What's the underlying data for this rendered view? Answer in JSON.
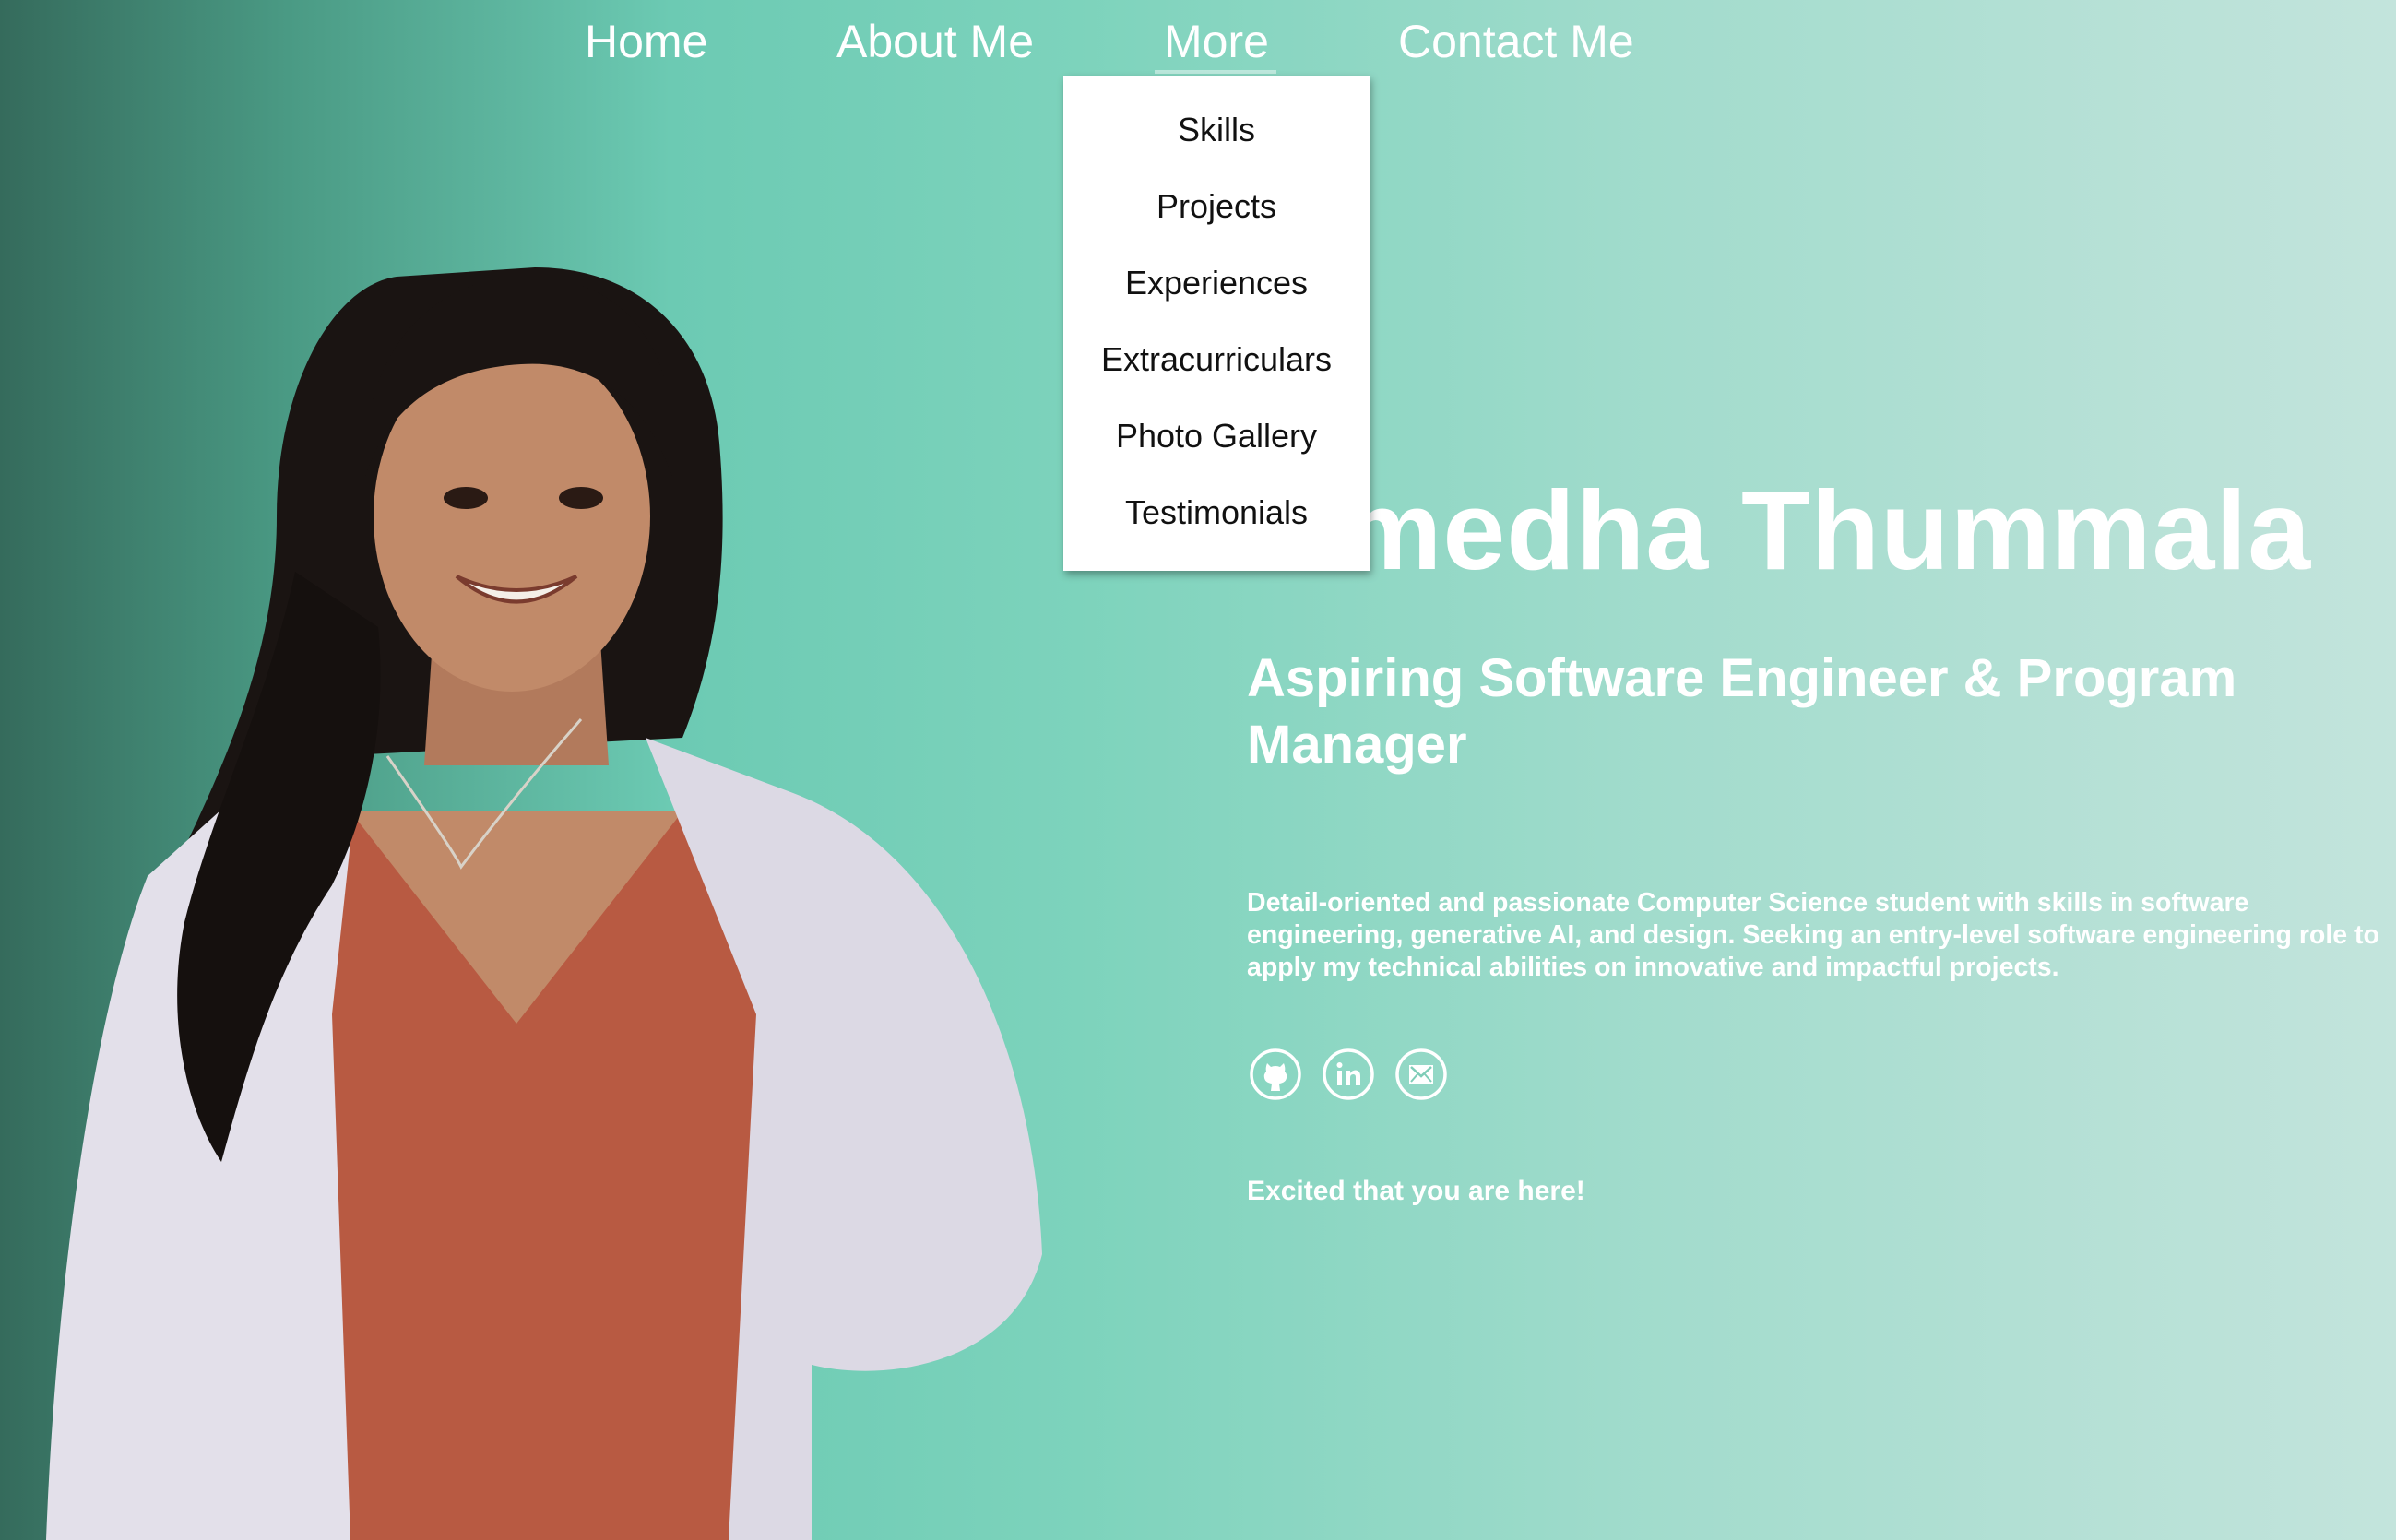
{
  "nav": {
    "home": "Home",
    "about": "About Me",
    "more": "More",
    "contact": "Contact Me"
  },
  "dropdown": {
    "items": [
      "Skills",
      "Projects",
      "Experiences",
      "Extracurriculars",
      "Photo Gallery",
      "Testimonials"
    ]
  },
  "hero": {
    "name": "imedha Thummala",
    "subtitle": "Aspiring Software Engineer & Program Manager",
    "description": "Detail-oriented and passionate Computer Science student with skills in software engineering, generative AI, and design. Seeking an entry-level software engineering role to apply my technical abilities on innovative and impactful projects.",
    "greeting": "Excited that you are here!"
  },
  "socials": [
    {
      "icon": "github-icon"
    },
    {
      "icon": "linkedin-icon"
    },
    {
      "icon": "mail-icon"
    }
  ],
  "colors": {
    "gradient_left": "#356b5c",
    "gradient_mid": "#6ccab3",
    "gradient_right": "#c3e4dc",
    "text": "#ffffff"
  }
}
